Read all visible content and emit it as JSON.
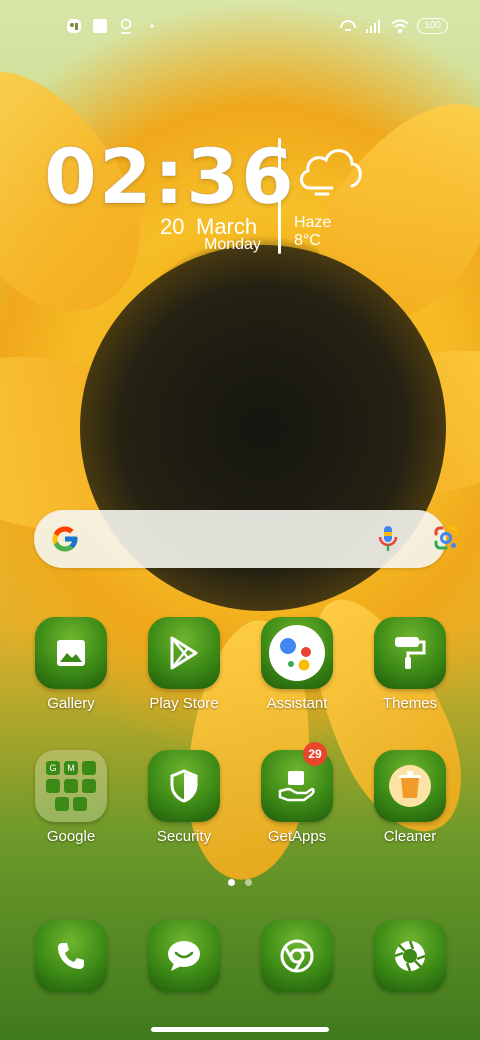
{
  "status_bar": {
    "battery": "100",
    "left_icons": [
      "gallery-app-icon",
      "square-notification-icon",
      "location-pin-icon",
      "dot-icon"
    ],
    "right_icons": [
      "hotspot-icon",
      "signal-icon",
      "wifi-icon",
      "battery-icon"
    ]
  },
  "clock_widget": {
    "time": "02:36",
    "day": "20",
    "month": "March",
    "weekday": "Monday"
  },
  "weather_widget": {
    "condition": "Haze",
    "temperature": "8°C",
    "icon": "cloud-icon"
  },
  "search_bar": {
    "icons": [
      "google-g-icon",
      "microphone-icon",
      "google-lens-icon"
    ]
  },
  "apps_row1": [
    {
      "label": "Gallery",
      "icon": "image-icon"
    },
    {
      "label": "Play Store",
      "icon": "play-store-icon"
    },
    {
      "label": "Assistant",
      "icon": "assistant-icon"
    },
    {
      "label": "Themes",
      "icon": "paint-roller-icon"
    }
  ],
  "apps_row2": [
    {
      "label": "Google",
      "icon": "folder-icon"
    },
    {
      "label": "Security",
      "icon": "shield-icon"
    },
    {
      "label": "GetApps",
      "icon": "getapps-icon",
      "badge": "29"
    },
    {
      "label": "Cleaner",
      "icon": "trash-icon"
    }
  ],
  "dock": [
    {
      "icon": "phone-icon"
    },
    {
      "icon": "messages-icon"
    },
    {
      "icon": "chrome-icon"
    },
    {
      "icon": "camera-icon"
    }
  ],
  "page_indicator": {
    "pages": 2,
    "active": 1
  },
  "colors": {
    "accent_green": "#3c8a16",
    "badge_red": "#e8472c",
    "wallpaper_yellow": "#f4b51c"
  }
}
